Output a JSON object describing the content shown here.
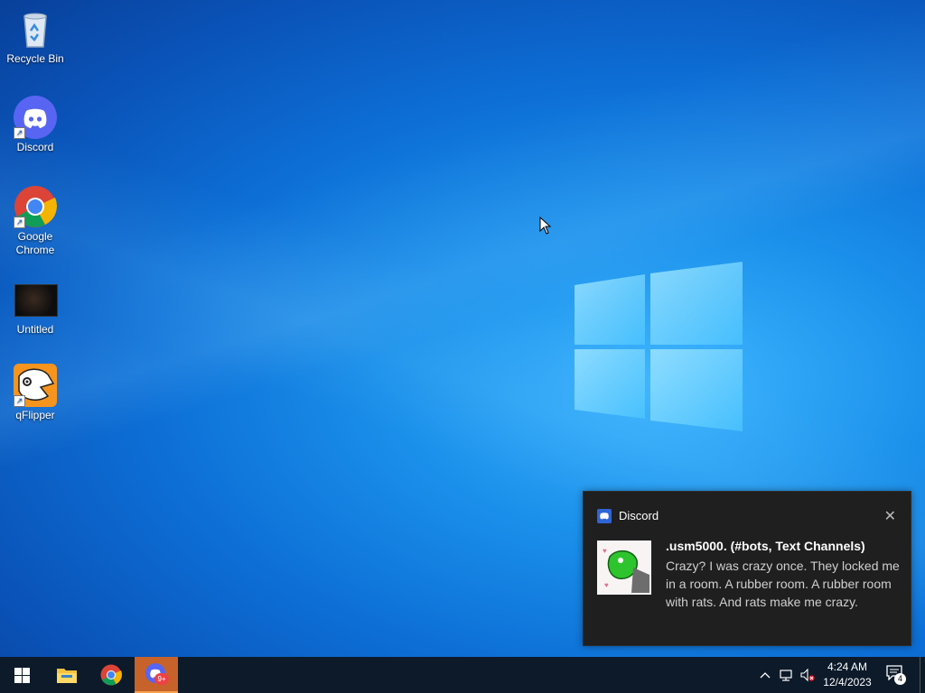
{
  "desktop": {
    "icons": [
      {
        "label": "Recycle Bin",
        "icon": "recycle-bin-icon"
      },
      {
        "label": "Discord",
        "icon": "discord-icon"
      },
      {
        "label": "Google Chrome",
        "icon": "chrome-icon"
      },
      {
        "label": "Untitled",
        "icon": "image-file-icon"
      },
      {
        "label": "qFlipper",
        "icon": "qflipper-icon"
      }
    ]
  },
  "notification": {
    "app_name": "Discord",
    "title": ".usm5000. (#bots, Text Channels)",
    "body": "Crazy? I was crazy once. They locked me in a room. A rubber room. A rubber room with rats. And rats make me crazy.",
    "close_glyph": "✕"
  },
  "taskbar": {
    "start": "windows-start-icon",
    "pinned": [
      "file-explorer-icon",
      "chrome-icon",
      "discord-icon"
    ],
    "discord_badge": "9+",
    "clock_time": "4:24 AM",
    "clock_date": "12/4/2023",
    "notifications_count": "4"
  },
  "colors": {
    "discord": "#5865F2",
    "active_task": "#c7622a",
    "taskbar": "#0c1a2a"
  }
}
